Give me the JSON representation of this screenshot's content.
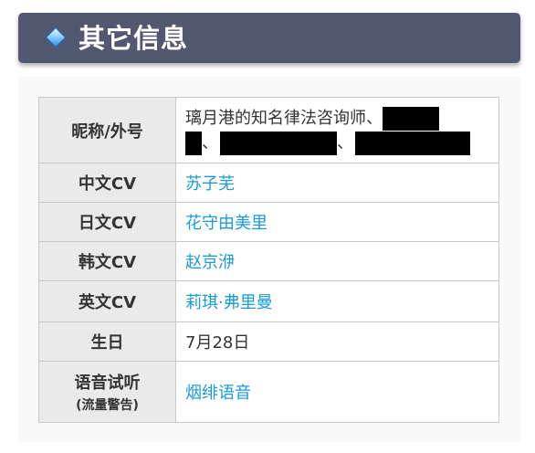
{
  "header": {
    "title": "其它信息",
    "diamond_icon": "diamond-icon"
  },
  "rows": [
    {
      "label": "昵称/外号",
      "value_text": "璃月港的知名律法咨询师、",
      "separator": "、"
    },
    {
      "label": "中文CV",
      "value": "苏子芜"
    },
    {
      "label": "日文CV",
      "value": "花守由美里"
    },
    {
      "label": "韩文CV",
      "value": "赵京洢"
    },
    {
      "label": "英文CV",
      "value": "莉琪·弗里曼"
    },
    {
      "label": "生日",
      "value": "7月28日"
    },
    {
      "label": "语音试听",
      "sub_label": "(流量警告)",
      "value": "烟绯语音"
    }
  ],
  "colors": {
    "header_bg": "#525870",
    "link": "#1a9bd7",
    "label_bg": "#eaeaea",
    "border": "#c8c8c8",
    "redaction": "#000000"
  }
}
